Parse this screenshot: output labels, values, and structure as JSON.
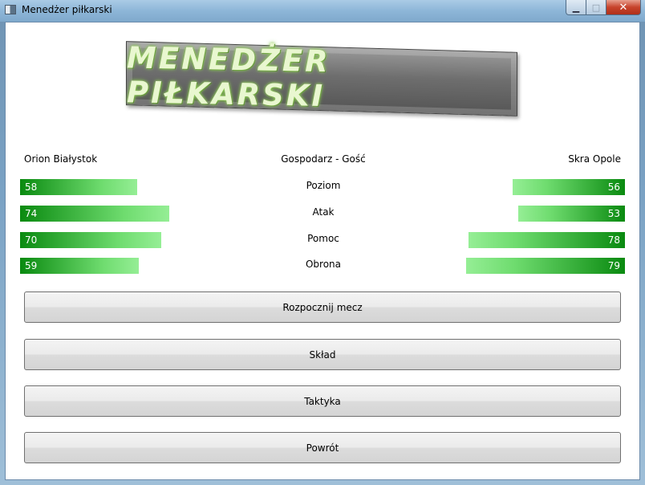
{
  "window": {
    "title": "Menedżer piłkarski",
    "buttons": {
      "minimize": "▁",
      "maximize": "□",
      "close": "✕"
    }
  },
  "logo": {
    "text": "MENEDŻER PIŁKARSKI"
  },
  "match": {
    "home_team": "Orion Białystok",
    "away_team": "Skra Opole",
    "header": "Gospodarz - Gość",
    "stats": [
      {
        "label": "Poziom",
        "home": "58",
        "away": "56"
      },
      {
        "label": "Atak",
        "home": "74",
        "away": "53"
      },
      {
        "label": "Pomoc",
        "home": "70",
        "away": "78"
      },
      {
        "label": "Obrona",
        "home": "59",
        "away": "79"
      }
    ]
  },
  "actions": {
    "start_match": "Rozpocznij mecz",
    "squad": "Skład",
    "tactics": "Taktyka",
    "back": "Powrót"
  },
  "colors": {
    "bar_dark": "#0a8a10",
    "bar_light": "#95ee95"
  }
}
